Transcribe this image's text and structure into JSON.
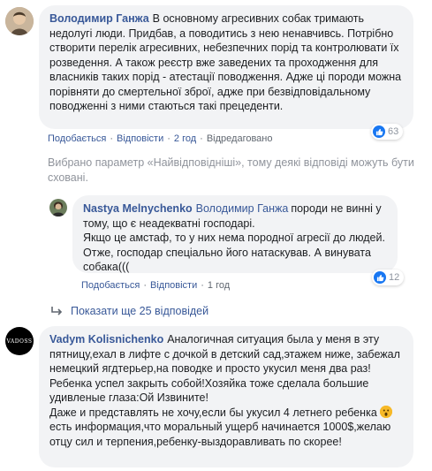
{
  "comments": [
    {
      "author": "Володимир Ганжа",
      "text": "В основному агресивних собак тримають недолугі люди. Придбав, а поводитись з нею ненавчивсь. Потрібно створити перелік агресивних, небезпечних порід та контролювати їх розведення. А також реєстр вже заведених та проходження для власників таких порід - атестації поводження. Адже ці породи можна порівняти до смертельної зброї, адже при безвідповідальному поводженні з ними стаються такі прецеденти.",
      "actions": {
        "like": "Подобається",
        "reply": "Відповісти",
        "time": "2 год",
        "edited": "Відредаговано"
      },
      "reaction_count": "63"
    }
  ],
  "filter_notice": "Вибрано параметр «Найвідповідніші», тому деякі відповіді можуть бути сховані.",
  "reply": {
    "author": "Nastya Melnychenko",
    "mention": "Володимир Ганжа",
    "text": "породи не винні у тому, що є неадекватні господарі.\nЯкщо це амстаф, то у них нема породної агресії до людей. Отже, господар спеціально його натаскував. А винувата собака(((",
    "actions": {
      "like": "Подобається",
      "reply": "Відповісти",
      "time": "1 год"
    },
    "reaction_count": "12"
  },
  "show_more": "Показати ще 25 відповідей",
  "comment2": {
    "author": "Vadym Kolisnichenko",
    "avatar_text": "VADOSS",
    "text_part1": "Аналогичная ситуация была у меня в эту пятницу,ехал в лифте с дочкой в детский сад,этажем ниже, забежал немецкий ягдтерьер,на поводке и просто укусил меня два раз!Ребенка успел закрыть собой!Хозяйка тоже сделала большие удивленые глаза:Ой Извините!\nДаже и представлять не хочу,если бы укусил 4 летнего ребенка ",
    "text_part2": "есть информация,что моральный ущерб начинается 1000$,желаю отцу сил и терпения,ребенку-выздоравливать по скорее!"
  },
  "colors": {
    "link": "#385898",
    "bubble": "#f2f3f5",
    "like_blue": "#1877f2",
    "muted": "#606770"
  }
}
